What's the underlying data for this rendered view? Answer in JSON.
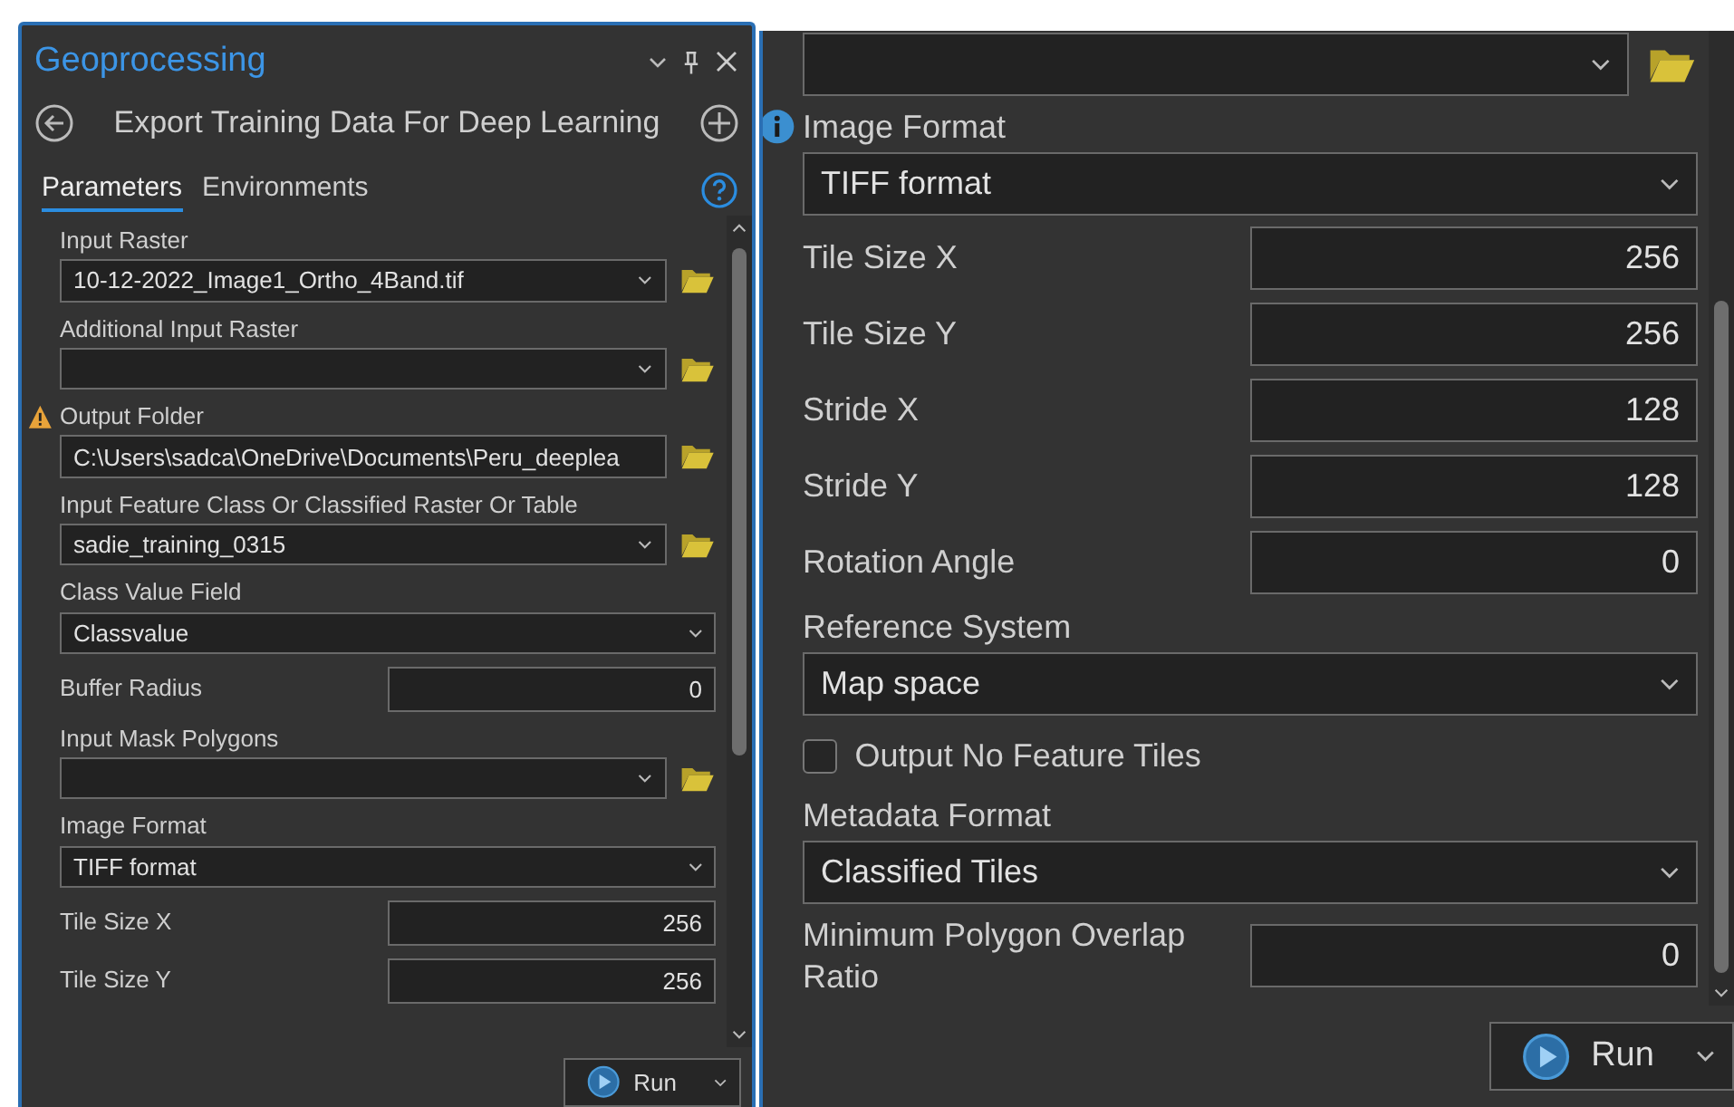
{
  "left_panel": {
    "title": "Geoprocessing",
    "tool_title": "Export Training Data For Deep Learning",
    "tabs": [
      {
        "label": "Parameters",
        "selected": true
      },
      {
        "label": "Environments",
        "selected": false
      }
    ],
    "parameters": [
      {
        "kind": "combo",
        "label": "Input Raster",
        "value": "10-12-2022_Image1_Ortho_4Band.tif",
        "browse": true
      },
      {
        "kind": "combo",
        "label": "Additional Input Raster",
        "browse": true
      },
      {
        "kind": "path",
        "label": "Output Folder",
        "value": "C:\\Users\\sadca\\OneDrive\\Documents\\Peru_deeplea",
        "browse": true,
        "warning": true
      },
      {
        "kind": "combo",
        "label": "Input Feature Class Or Classified Raster Or Table",
        "value": "sadie_training_0315",
        "browse": true
      },
      {
        "kind": "combo",
        "label": "Class Value Field",
        "value": "Classvalue",
        "browse": false
      },
      {
        "kind": "number",
        "label": "Buffer Radius",
        "value": "0"
      },
      {
        "kind": "combo",
        "label": "Input Mask Polygons",
        "browse": true
      },
      {
        "kind": "combo",
        "label": "Image Format",
        "value": "TIFF format",
        "browse": false
      },
      {
        "kind": "number",
        "label": "Tile Size X",
        "value": "256"
      },
      {
        "kind": "number",
        "label": "Tile Size Y",
        "value": "256"
      }
    ],
    "run_button": {
      "label": "Run"
    }
  },
  "right_panel": {
    "parameters": [
      {
        "kind": "combo",
        "browse": true
      },
      {
        "kind": "combo",
        "label": "Image Format",
        "value": "TIFF format",
        "browse": false,
        "info": true
      },
      {
        "kind": "number",
        "label": "Tile Size X",
        "value": "256"
      },
      {
        "kind": "number",
        "label": "Tile Size Y",
        "value": "256"
      },
      {
        "kind": "number",
        "label": "Stride X",
        "value": "128"
      },
      {
        "kind": "number",
        "label": "Stride Y",
        "value": "128"
      },
      {
        "kind": "number",
        "label": "Rotation Angle",
        "value": "0"
      },
      {
        "kind": "combo",
        "label": "Reference System",
        "value": "Map space",
        "browse": false
      },
      {
        "kind": "checkbox",
        "label": "Output No Feature Tiles",
        "checked": false
      },
      {
        "kind": "combo",
        "label": "Metadata Format",
        "value": "Classified Tiles",
        "browse": false
      },
      {
        "kind": "number",
        "label": "Minimum Polygon Overlap Ratio",
        "value": "0"
      }
    ],
    "run_button": {
      "label": "Run"
    }
  }
}
